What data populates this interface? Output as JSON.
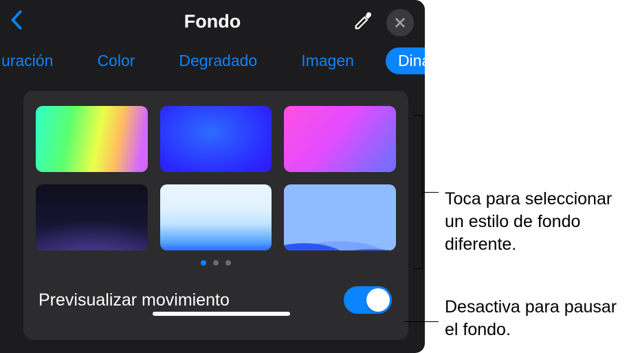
{
  "header": {
    "title": "Fondo"
  },
  "tabs": {
    "items": [
      {
        "label": "uración"
      },
      {
        "label": "Color"
      },
      {
        "label": "Degradado"
      },
      {
        "label": "Imagen"
      },
      {
        "label": "Dinámico"
      }
    ],
    "active_index": 4
  },
  "swatches": [
    {
      "id": "dynamic-1"
    },
    {
      "id": "dynamic-2"
    },
    {
      "id": "dynamic-3"
    },
    {
      "id": "dynamic-4"
    },
    {
      "id": "dynamic-5"
    },
    {
      "id": "dynamic-6"
    }
  ],
  "pagination": {
    "count": 3,
    "active": 0
  },
  "preview": {
    "label": "Previsualizar movimiento",
    "toggle_on": true
  },
  "callouts": {
    "grid": "Toca para seleccionar un estilo de fondo diferente.",
    "toggle": "Desactiva para pausar el fondo."
  },
  "icons": {
    "back": "chevron-left",
    "eyedropper": "eyedropper",
    "close": "xmark"
  },
  "colors": {
    "accent": "#0a84ff",
    "panel_bg": "#1c1c1e",
    "card_bg": "#2c2c2e"
  }
}
